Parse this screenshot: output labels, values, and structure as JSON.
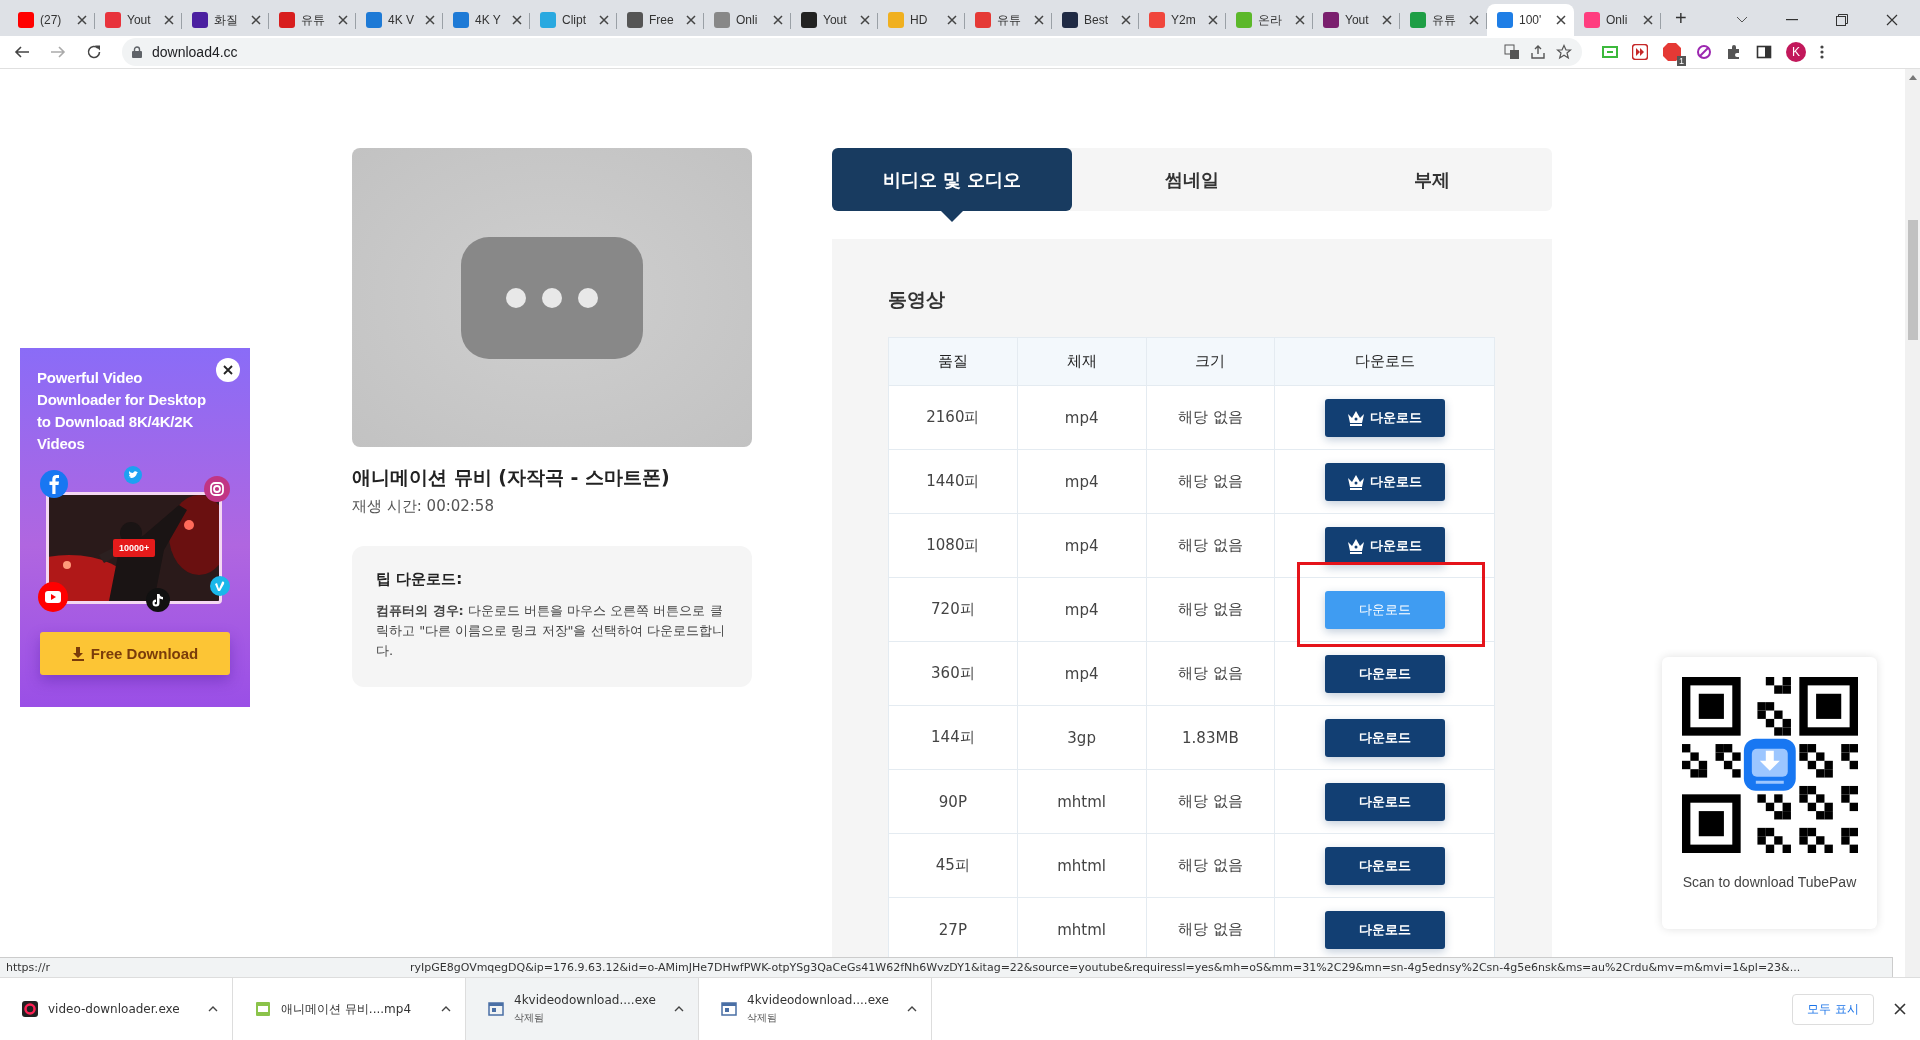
{
  "browser": {
    "tabs": [
      {
        "title": "(27)",
        "color": "#ff0000",
        "selected": false
      },
      {
        "title": "Yout",
        "color": "#e8333c",
        "selected": false
      },
      {
        "title": "화질",
        "color": "#4b1fa0",
        "selected": false
      },
      {
        "title": "유튜",
        "color": "#d81e1e",
        "selected": false
      },
      {
        "title": "4K V",
        "color": "#1e7ad6",
        "selected": false
      },
      {
        "title": "4K Y",
        "color": "#1e7ad6",
        "selected": false
      },
      {
        "title": "Clipt",
        "color": "#2aa9e0",
        "selected": false
      },
      {
        "title": "Free",
        "color": "#555555",
        "selected": false
      },
      {
        "title": "Onli",
        "color": "#888888",
        "selected": false
      },
      {
        "title": "Yout",
        "color": "#222222",
        "selected": false
      },
      {
        "title": "HD",
        "color": "#f0b020",
        "selected": false
      },
      {
        "title": "유튜",
        "color": "#e53935",
        "selected": false
      },
      {
        "title": "Best",
        "color": "#1f2a44",
        "selected": false
      },
      {
        "title": "Y2m",
        "color": "#f0463c",
        "selected": false
      },
      {
        "title": "온라",
        "color": "#5cb82a",
        "selected": false
      },
      {
        "title": "Yout",
        "color": "#7a1f6e",
        "selected": false
      },
      {
        "title": "유튜",
        "color": "#1e9e45",
        "selected": false
      },
      {
        "title": "100'",
        "color": "#1e7ee6",
        "selected": true
      },
      {
        "title": "Onli",
        "color": "#ff3d7f",
        "selected": false
      }
    ],
    "new_tab": "+",
    "address": "download4.cc",
    "extension_badge": "1",
    "profile_initial": "K"
  },
  "ad": {
    "headline": "Powerful Video Downloader for Desktop to Download 8K/4K/2K Videos",
    "badge": "10000+",
    "button": "Free Download"
  },
  "video": {
    "title": "애니메이션 뮤비 (자작곡 - 스마트폰)",
    "duration": "재생 시간: 00:02:58"
  },
  "tip": {
    "heading": "팁 다운로드:",
    "text": "**컴퓨터의 경우:** 다운로드 버튼을 마우스 오른쪽 버튼으로 클릭하고 \"다른 이름으로 링크 저장\"을 선택하여 다운로드합니다."
  },
  "format_tabs": [
    {
      "label": "비디오 및 오디오",
      "selected": true
    },
    {
      "label": "썸네일",
      "selected": false
    },
    {
      "label": "부제",
      "selected": false
    }
  ],
  "section_title": "동영상",
  "table": {
    "columns": [
      "품질",
      "체재",
      "크기",
      "다운로드"
    ],
    "rows": [
      {
        "quality": "2160피",
        "format": "mp4",
        "size": "해당 없음",
        "button": "다운로드",
        "kind": "premium",
        "hovered": false,
        "highlighted": false
      },
      {
        "quality": "1440피",
        "format": "mp4",
        "size": "해당 없음",
        "button": "다운로드",
        "kind": "premium",
        "hovered": false,
        "highlighted": false
      },
      {
        "quality": "1080피",
        "format": "mp4",
        "size": "해당 없음",
        "button": "다운로드",
        "kind": "premium",
        "hovered": false,
        "highlighted": false
      },
      {
        "quality": "720피",
        "format": "mp4",
        "size": "해당 없음",
        "button": "다운로드",
        "kind": "free",
        "hovered": true,
        "highlighted": true
      },
      {
        "quality": "360피",
        "format": "mp4",
        "size": "해당 없음",
        "button": "다운로드",
        "kind": "free",
        "hovered": false,
        "highlighted": false
      },
      {
        "quality": "144피",
        "format": "3gp",
        "size": "1.83MB",
        "button": "다운로드",
        "kind": "free",
        "hovered": false,
        "highlighted": false
      },
      {
        "quality": "90P",
        "format": "mhtml",
        "size": "해당 없음",
        "button": "다운로드",
        "kind": "free",
        "hovered": false,
        "highlighted": false
      },
      {
        "quality": "45피",
        "format": "mhtml",
        "size": "해당 없음",
        "button": "다운로드",
        "kind": "free",
        "hovered": false,
        "highlighted": false
      },
      {
        "quality": "27P",
        "format": "mhtml",
        "size": "해당 없음",
        "button": "다운로드",
        "kind": "free",
        "hovered": false,
        "highlighted": false
      }
    ]
  },
  "qr": {
    "caption": "Scan to download TubePaw"
  },
  "status_url": {
    "start": "https://r",
    "end": "ryIpGE8gOVmqegDQ&ip=176.9.63.12&id=o-AMimJHe7DHwfPWK-otpYSg3QaCeGs41W62fNh6WvzDY1&itag=22&source=youtube&requiressl=yes&mh=oS&mm=31%2C29&mn=sn-4g5ednsy%2Csn-4g5e6nsk&ms=au%2Crdu&mv=m&mvi=1&pl=23&..."
  },
  "downloads": [
    {
      "name": "video-downloader.exe",
      "kind": "app"
    },
    {
      "name": "애니메이션 뮤비....mp4",
      "kind": "video"
    },
    {
      "name": "4kvideodownload....exe",
      "kind": "installer",
      "status": "삭제됨"
    },
    {
      "name": "4kvideodownload....exe",
      "kind": "installer",
      "status": "삭제됨"
    }
  ],
  "show_all": "모두 표시"
}
